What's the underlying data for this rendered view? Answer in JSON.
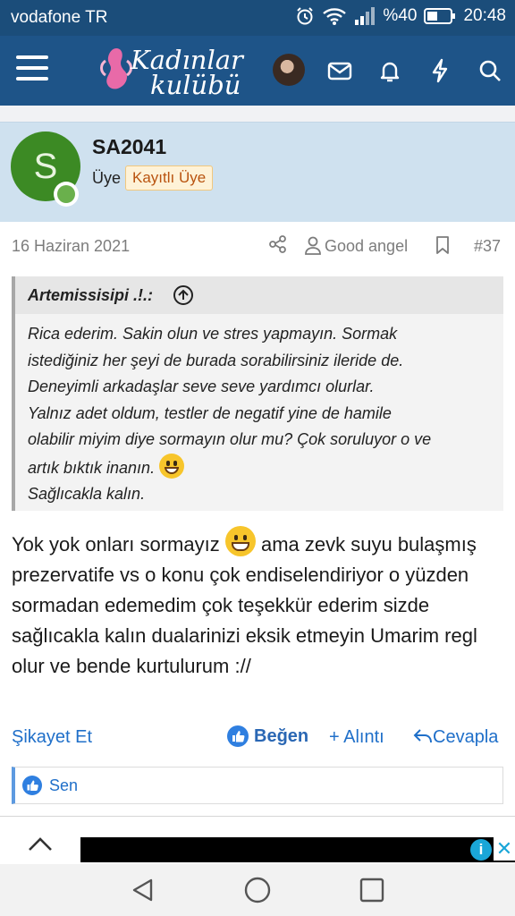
{
  "statusbar": {
    "carrier": "vodafone TR",
    "battery": "%40",
    "time": "20:48"
  },
  "appbar": {
    "logo_line1": "Kadınlar",
    "logo_line2": "kulübü"
  },
  "post": {
    "username": "SA2041",
    "avatar_letter": "S",
    "role": "Üye",
    "badge": "Kayıtlı Üye",
    "date": "16 Haziran 2021",
    "reacted_user": "Good angel",
    "post_number": "#37",
    "quote": {
      "author": "Artemissisipi .!.:",
      "lines": [
        "Rica ederim. Sakin olun ve stres yapmayın. Sormak",
        "istediğiniz her şeyi de burada sorabilirsiniz ileride de.",
        "Deneyimli arkadaşlar seve seve yardımcı olurlar.",
        "Yalnız adet oldum, testler de negatif yine de hamile",
        "olabilir miyim diye sormayın olur mu? Çok soruluyor o ve",
        "artık bıktık inanın.",
        "Sağlıcakla kalın."
      ]
    },
    "body_part1": "Yok yok onları sormayız",
    "body_part2": "ama zevk suyu bulaşmış prezervatife vs o konu çok endiselendiriyor o yüzden sormadan edemedim çok teşekkür ederim sizde sağlıcakla kalın dualarinizi eksik etmeyin Umarim regl olur ve bende kurtulurum ://",
    "actions": {
      "report": "Şikayet Et",
      "like": "Beğen",
      "quote": "+ Alıntı",
      "reply": "Cevapla"
    },
    "likes": "Sen"
  },
  "colors": {
    "appbar": "#1e5488",
    "user_panel": "#cfe1ef",
    "link": "#1f6fc9",
    "badge_text": "#b9530f"
  }
}
